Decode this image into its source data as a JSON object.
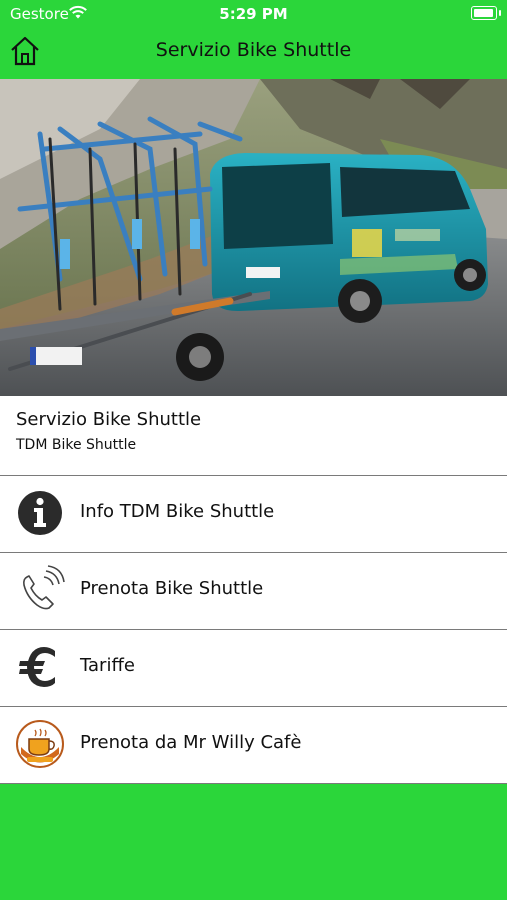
{
  "status_bar": {
    "carrier": "Gestore",
    "time": "5:29 PM"
  },
  "nav": {
    "title": "Servizio Bike Shuttle",
    "home_icon": "home-icon"
  },
  "header": {
    "title": "Servizio Bike Shuttle",
    "subtitle": "TDM Bike Shuttle"
  },
  "menu": [
    {
      "label": "Info TDM Bike Shuttle",
      "icon": "info-icon"
    },
    {
      "label": "Prenota Bike Shuttle",
      "icon": "phone-icon"
    },
    {
      "label": "Tariffe",
      "icon": "euro-icon"
    },
    {
      "label": "Prenota da Mr Willy Cafè",
      "icon": "cafe-logo-icon"
    }
  ],
  "colors": {
    "brand_green": "#2bd63a",
    "van_teal": "#1e8fa0"
  }
}
